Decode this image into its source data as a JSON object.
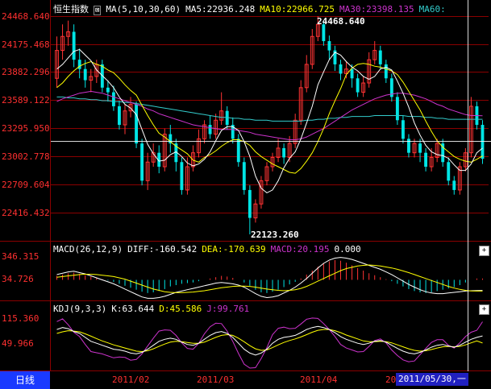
{
  "colors": {
    "up": "#ff3333",
    "down": "#00e5e5",
    "ma5": "#ffffff",
    "ma10": "#ffff00",
    "ma30": "#cc33cc",
    "ma60": "#33cccc",
    "axis_text": "#ff3030",
    "grid": "#8b0000",
    "cursor": "#ffffff"
  },
  "main_legend": {
    "title": "恒生指数",
    "params": "MA(5,10,30,60)",
    "ma5": "MA5:22936.248",
    "ma10": "MA10:22966.725",
    "ma30": "MA30:23398.135",
    "ma60": "MA60:"
  },
  "main_axis": [
    "24468.640",
    "24175.468",
    "23882.296",
    "23589.122",
    "23295.950",
    "23002.778",
    "22709.604",
    "22416.432"
  ],
  "max_label": "24468.640",
  "min_label": "22123.260",
  "macd_legend": {
    "name": "MACD(26,12,9)",
    "diff": "DIFF:-160.542",
    "dea": "DEA:-170.639",
    "macd": "MACD:20.195",
    "zero": "0.000"
  },
  "macd_axis": [
    "346.315",
    "34.726"
  ],
  "kdj_legend": {
    "name": "KDJ(9,3,3)",
    "k": "K:63.644",
    "d": "D:45.586",
    "j": "J:99.761"
  },
  "kdj_axis": [
    "115.360",
    "49.966"
  ],
  "period_tab": "日线",
  "x_labels": [
    "2011/02",
    "2011/03",
    "2011/04",
    "20"
  ],
  "cursor_date": "2011/05/30,一",
  "buttons": {
    "plus": "+"
  },
  "chart_data": {
    "type": "candlestick",
    "title": "恒生指数",
    "ylim": [
      22123.26,
      24468.64
    ],
    "candles": [
      {
        "o": 23800,
        "c": 24100,
        "h": 24250,
        "l": 23700
      },
      {
        "o": 24100,
        "c": 24250,
        "h": 24380,
        "l": 24000
      },
      {
        "o": 24250,
        "c": 24300,
        "h": 24420,
        "l": 24150
      },
      {
        "o": 24300,
        "c": 24000,
        "h": 24380,
        "l": 23920
      },
      {
        "o": 24000,
        "c": 23900,
        "h": 24120,
        "l": 23800
      },
      {
        "o": 23900,
        "c": 23780,
        "h": 24000,
        "l": 23700
      },
      {
        "o": 23780,
        "c": 23820,
        "h": 23900,
        "l": 23650
      },
      {
        "o": 23820,
        "c": 23950,
        "h": 24000,
        "l": 23750
      },
      {
        "o": 23950,
        "c": 23700,
        "h": 24000,
        "l": 23650
      },
      {
        "o": 23700,
        "c": 23650,
        "h": 23780,
        "l": 23550
      },
      {
        "o": 23650,
        "c": 23500,
        "h": 23720,
        "l": 23450
      },
      {
        "o": 23500,
        "c": 23300,
        "h": 23560,
        "l": 23250
      },
      {
        "o": 23300,
        "c": 23450,
        "h": 23520,
        "l": 23200
      },
      {
        "o": 23450,
        "c": 23520,
        "h": 23600,
        "l": 23380
      },
      {
        "o": 23520,
        "c": 23100,
        "h": 23550,
        "l": 23050
      },
      {
        "o": 23100,
        "c": 22700,
        "h": 23150,
        "l": 22650
      },
      {
        "o": 22700,
        "c": 22900,
        "h": 23000,
        "l": 22600
      },
      {
        "o": 22900,
        "c": 23000,
        "h": 23100,
        "l": 22850
      },
      {
        "o": 23000,
        "c": 22850,
        "h": 23080,
        "l": 22780
      },
      {
        "o": 22850,
        "c": 23200,
        "h": 23260,
        "l": 22800
      },
      {
        "o": 23200,
        "c": 23100,
        "h": 23300,
        "l": 23000
      },
      {
        "o": 23100,
        "c": 22900,
        "h": 23150,
        "l": 22800
      },
      {
        "o": 22900,
        "c": 22600,
        "h": 22950,
        "l": 22550
      },
      {
        "o": 22600,
        "c": 22850,
        "h": 22950,
        "l": 22550
      },
      {
        "o": 22850,
        "c": 23000,
        "h": 23080,
        "l": 22800
      },
      {
        "o": 23000,
        "c": 23150,
        "h": 23250,
        "l": 22950
      },
      {
        "o": 23150,
        "c": 23300,
        "h": 23350,
        "l": 23100
      },
      {
        "o": 23300,
        "c": 23200,
        "h": 23400,
        "l": 23150
      },
      {
        "o": 23200,
        "c": 23350,
        "h": 23420,
        "l": 23150
      },
      {
        "o": 23350,
        "c": 23450,
        "h": 23650,
        "l": 23300
      },
      {
        "o": 23450,
        "c": 23300,
        "h": 23500,
        "l": 23250
      },
      {
        "o": 23300,
        "c": 23150,
        "h": 23380,
        "l": 23100
      },
      {
        "o": 23150,
        "c": 22900,
        "h": 23200,
        "l": 22850
      },
      {
        "o": 22900,
        "c": 22600,
        "h": 22950,
        "l": 22550
      },
      {
        "o": 22600,
        "c": 22300,
        "h": 22650,
        "l": 22123.26
      },
      {
        "o": 22300,
        "c": 22450,
        "h": 22500,
        "l": 22250
      },
      {
        "o": 22450,
        "c": 22700,
        "h": 22750,
        "l": 22400
      },
      {
        "o": 22700,
        "c": 22850,
        "h": 22900,
        "l": 22650
      },
      {
        "o": 22850,
        "c": 22950,
        "h": 23000,
        "l": 22800
      },
      {
        "o": 22950,
        "c": 23050,
        "h": 23150,
        "l": 22900
      },
      {
        "o": 23050,
        "c": 22950,
        "h": 23100,
        "l": 22880
      },
      {
        "o": 22950,
        "c": 23100,
        "h": 23180,
        "l": 22900
      },
      {
        "o": 23100,
        "c": 23350,
        "h": 23420,
        "l": 23050
      },
      {
        "o": 23350,
        "c": 23700,
        "h": 23780,
        "l": 23300
      },
      {
        "o": 23700,
        "c": 23950,
        "h": 24050,
        "l": 23650
      },
      {
        "o": 23950,
        "c": 24250,
        "h": 24330,
        "l": 23900
      },
      {
        "o": 24250,
        "c": 24380,
        "h": 24468.64,
        "l": 24200
      },
      {
        "o": 24380,
        "c": 24200,
        "h": 24420,
        "l": 24150
      },
      {
        "o": 24200,
        "c": 24100,
        "h": 24260,
        "l": 24000
      },
      {
        "o": 24100,
        "c": 23950,
        "h": 24150,
        "l": 23880
      },
      {
        "o": 23950,
        "c": 23850,
        "h": 24000,
        "l": 23780
      },
      {
        "o": 23850,
        "c": 23900,
        "h": 23980,
        "l": 23800
      },
      {
        "o": 23900,
        "c": 23800,
        "h": 23950,
        "l": 23700
      },
      {
        "o": 23800,
        "c": 23650,
        "h": 23850,
        "l": 23600
      },
      {
        "o": 23650,
        "c": 23750,
        "h": 23820,
        "l": 23600
      },
      {
        "o": 23750,
        "c": 24000,
        "h": 24080,
        "l": 23700
      },
      {
        "o": 24000,
        "c": 24100,
        "h": 24200,
        "l": 23950
      },
      {
        "o": 24100,
        "c": 23950,
        "h": 24150,
        "l": 23900
      },
      {
        "o": 23950,
        "c": 23800,
        "h": 24000,
        "l": 23750
      },
      {
        "o": 23800,
        "c": 23600,
        "h": 23850,
        "l": 23550
      },
      {
        "o": 23600,
        "c": 23350,
        "h": 23650,
        "l": 23300
      },
      {
        "o": 23350,
        "c": 23150,
        "h": 23400,
        "l": 23100
      },
      {
        "o": 23150,
        "c": 23000,
        "h": 23200,
        "l": 22950
      },
      {
        "o": 23000,
        "c": 23100,
        "h": 23150,
        "l": 22950
      },
      {
        "o": 23100,
        "c": 23000,
        "h": 23150,
        "l": 22900
      },
      {
        "o": 23000,
        "c": 22850,
        "h": 23050,
        "l": 22800
      },
      {
        "o": 22850,
        "c": 22950,
        "h": 23050,
        "l": 22800
      },
      {
        "o": 22950,
        "c": 23100,
        "h": 23150,
        "l": 22900
      },
      {
        "o": 23100,
        "c": 22900,
        "h": 23150,
        "l": 22850
      },
      {
        "o": 22900,
        "c": 22700,
        "h": 22950,
        "l": 22650
      },
      {
        "o": 22700,
        "c": 22600,
        "h": 22750,
        "l": 22550
      },
      {
        "o": 22600,
        "c": 22850,
        "h": 22900,
        "l": 22550
      },
      {
        "o": 22850,
        "c": 23000,
        "h": 23050,
        "l": 22800
      },
      {
        "o": 23000,
        "c": 23500,
        "h": 23600,
        "l": 22950
      },
      {
        "o": 23500,
        "c": 23300,
        "h": 23550,
        "l": 23250
      },
      {
        "o": 23300,
        "c": 22936,
        "h": 23350,
        "l": 22880
      }
    ],
    "ma5": [
      23900,
      23950,
      24020,
      24090,
      24110,
      24050,
      23990,
      23890,
      23830,
      23770,
      23700,
      23600,
      23520,
      23480,
      23410,
      23250,
      23090,
      22990,
      22910,
      22920,
      22980,
      23010,
      22960,
      22890,
      22860,
      22880,
      22930,
      23010,
      23130,
      23240,
      23280,
      23280,
      23240,
      23120,
      22960,
      22750,
      22620,
      22570,
      22600,
      22700,
      22840,
      22940,
      23010,
      23150,
      23320,
      23500,
      23730,
      23870,
      24000,
      24080,
      24050,
      23980,
      23920,
      23880,
      23820,
      23790,
      23820,
      23900,
      23920,
      23890,
      23770,
      23640,
      23490,
      23320,
      23190,
      23080,
      23010,
      22980,
      22970,
      22940,
      22870,
      22810,
      22810,
      22880,
      23000,
      23050
    ],
    "ma10": [
      23700,
      23750,
      23820,
      23880,
      23930,
      23960,
      23980,
      23950,
      23930,
      23890,
      23860,
      23800,
      23730,
      23670,
      23620,
      23510,
      23400,
      23300,
      23210,
      23170,
      23120,
      23070,
      23030,
      22990,
      22920,
      22900,
      22950,
      22980,
      23020,
      23070,
      23110,
      23140,
      23140,
      23120,
      23080,
      23010,
      22960,
      22920,
      22880,
      22850,
      22820,
      22790,
      22780,
      22830,
      22910,
      23000,
      23120,
      23260,
      23420,
      23560,
      23690,
      23840,
      23910,
      23950,
      23960,
      23950,
      23930,
      23920,
      23900,
      23880,
      23840,
      23760,
      23660,
      23560,
      23460,
      23340,
      23230,
      23130,
      23060,
      23010,
      22960,
      22930,
      22910,
      22900,
      22930,
      22966
    ],
    "ma30": [
      23550,
      23580,
      23600,
      23620,
      23640,
      23650,
      23660,
      23650,
      23640,
      23620,
      23600,
      23580,
      23560,
      23540,
      23520,
      23500,
      23470,
      23450,
      23420,
      23400,
      23380,
      23360,
      23340,
      23320,
      23300,
      23290,
      23280,
      23270,
      23260,
      23250,
      23250,
      23250,
      23240,
      23230,
      23220,
      23200,
      23190,
      23180,
      23170,
      23160,
      23150,
      23140,
      23140,
      23150,
      23170,
      23200,
      23230,
      23260,
      23300,
      23340,
      23380,
      23420,
      23460,
      23490,
      23520,
      23550,
      23580,
      23600,
      23620,
      23630,
      23640,
      23640,
      23630,
      23620,
      23600,
      23580,
      23550,
      23520,
      23500,
      23470,
      23450,
      23430,
      23410,
      23400,
      23400,
      23398
    ],
    "ma60": [
      23600,
      23600,
      23590,
      23590,
      23580,
      23580,
      23570,
      23570,
      23560,
      23560,
      23550,
      23550,
      23540,
      23540,
      23530,
      23520,
      23510,
      23500,
      23490,
      23480,
      23470,
      23460,
      23450,
      23440,
      23430,
      23420,
      23410,
      23400,
      23390,
      23380,
      23380,
      23370,
      23370,
      23360,
      23360,
      23350,
      23350,
      23350,
      23340,
      23340,
      23340,
      23340,
      23340,
      23340,
      23350,
      23350,
      23360,
      23360,
      23370,
      23370,
      23380,
      23380,
      23390,
      23390,
      23390,
      23390,
      23400,
      23400,
      23400,
      23400,
      23400,
      23400,
      23390,
      23390,
      23390,
      23380,
      23380,
      23370,
      23370,
      23360,
      23360,
      23360,
      23360,
      23360,
      23360,
      23360
    ],
    "macd_hist": [
      60,
      80,
      100,
      110,
      90,
      70,
      50,
      30,
      10,
      -10,
      -30,
      -60,
      -90,
      -120,
      -150,
      -180,
      -200,
      -190,
      -170,
      -140,
      -100,
      -80,
      -60,
      -50,
      -40,
      -20,
      0,
      20,
      40,
      60,
      50,
      30,
      0,
      -40,
      -90,
      -150,
      -190,
      -200,
      -180,
      -150,
      -110,
      -70,
      -30,
      20,
      80,
      140,
      200,
      250,
      280,
      300,
      290,
      260,
      220,
      180,
      140,
      100,
      70,
      40,
      10,
      -20,
      -60,
      -100,
      -140,
      -170,
      -190,
      -200,
      -190,
      -170,
      -150,
      -130,
      -110,
      -80,
      -40,
      0,
      20,
      20
    ],
    "macd_diff": [
      80,
      100,
      120,
      130,
      110,
      90,
      60,
      30,
      0,
      -30,
      -60,
      -100,
      -140,
      -180,
      -220,
      -260,
      -280,
      -280,
      -270,
      -250,
      -220,
      -190,
      -170,
      -150,
      -130,
      -110,
      -90,
      -70,
      -50,
      -40,
      -50,
      -60,
      -80,
      -110,
      -160,
      -210,
      -250,
      -270,
      -260,
      -240,
      -200,
      -160,
      -110,
      -50,
      20,
      100,
      180,
      250,
      300,
      330,
      340,
      330,
      310,
      280,
      250,
      220,
      190,
      160,
      120,
      80,
      30,
      -20,
      -70,
      -110,
      -150,
      -180,
      -200,
      -210,
      -210,
      -200,
      -190,
      -180,
      -170,
      -165,
      -162,
      -160.542
    ],
    "macd_dea": [
      40,
      50,
      60,
      70,
      80,
      85,
      85,
      80,
      70,
      60,
      50,
      30,
      10,
      -20,
      -50,
      -80,
      -110,
      -140,
      -160,
      -180,
      -190,
      -195,
      -195,
      -190,
      -185,
      -175,
      -165,
      -150,
      -135,
      -120,
      -110,
      -100,
      -95,
      -95,
      -100,
      -110,
      -125,
      -140,
      -150,
      -160,
      -165,
      -160,
      -150,
      -130,
      -100,
      -60,
      -20,
      20,
      60,
      100,
      140,
      170,
      190,
      210,
      220,
      225,
      220,
      210,
      195,
      180,
      160,
      135,
      110,
      80,
      50,
      20,
      -10,
      -40,
      -70,
      -100,
      -125,
      -145,
      -160,
      -168,
      -170,
      -170.639
    ],
    "kdj_k": [
      80,
      85,
      82,
      75,
      70,
      60,
      50,
      45,
      40,
      35,
      30,
      28,
      25,
      20,
      18,
      22,
      30,
      40,
      50,
      55,
      58,
      55,
      48,
      42,
      40,
      45,
      55,
      65,
      72,
      75,
      70,
      60,
      45,
      30,
      20,
      15,
      20,
      30,
      45,
      55,
      60,
      62,
      65,
      72,
      80,
      85,
      88,
      85,
      80,
      72,
      62,
      55,
      50,
      45,
      42,
      45,
      50,
      52,
      48,
      40,
      32,
      25,
      20,
      18,
      22,
      28,
      35,
      40,
      42,
      38,
      35,
      40,
      48,
      55,
      60,
      63.644
    ],
    "kdj_d": [
      70,
      74,
      77,
      76,
      74,
      69,
      63,
      57,
      51,
      46,
      41,
      37,
      33,
      29,
      25,
      24,
      26,
      31,
      37,
      43,
      48,
      50,
      49,
      47,
      45,
      45,
      48,
      54,
      60,
      65,
      67,
      65,
      58,
      49,
      39,
      31,
      27,
      28,
      34,
      41,
      47,
      52,
      56,
      61,
      67,
      73,
      78,
      80,
      80,
      77,
      72,
      66,
      61,
      56,
      51,
      49,
      49,
      50,
      49,
      46,
      41,
      36,
      31,
      27,
      25,
      26,
      29,
      33,
      36,
      37,
      36,
      37,
      41,
      46,
      51,
      45.586
    ],
    "kdj_j": [
      100,
      107,
      92,
      73,
      62,
      42,
      24,
      21,
      18,
      13,
      8,
      10,
      9,
      2,
      4,
      18,
      38,
      58,
      76,
      79,
      78,
      65,
      46,
      32,
      30,
      45,
      69,
      87,
      96,
      95,
      76,
      50,
      19,
      -8,
      -18,
      -17,
      6,
      34,
      67,
      83,
      86,
      82,
      83,
      94,
      106,
      109,
      108,
      95,
      80,
      62,
      42,
      33,
      28,
      23,
      24,
      37,
      52,
      56,
      46,
      28,
      14,
      3,
      -2,
      0,
      16,
      32,
      47,
      54,
      54,
      40,
      33,
      46,
      62,
      73,
      78,
      99.761
    ]
  }
}
